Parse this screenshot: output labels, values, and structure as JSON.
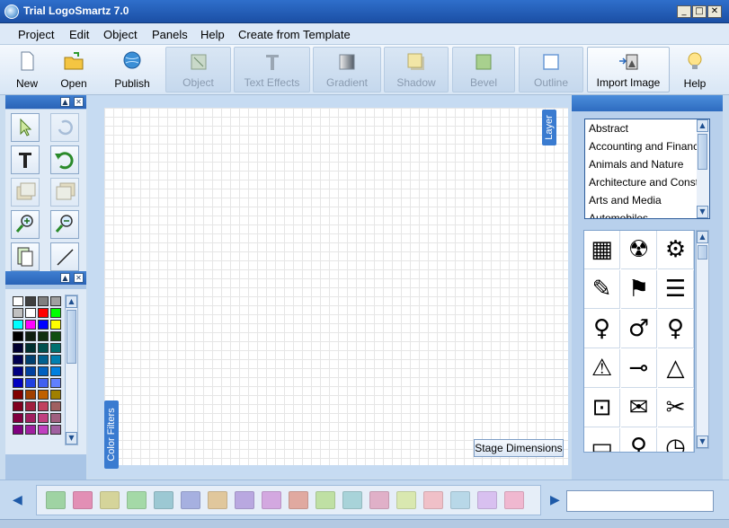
{
  "window": {
    "title": "Trial LogoSmartz 7.0",
    "minimize": "_",
    "maximize": "□",
    "close": "✕"
  },
  "menu": [
    "Project",
    "Edit",
    "Object",
    "Panels",
    "Help",
    "Create from Template"
  ],
  "toolbar": {
    "new": "New",
    "open": "Open",
    "publish": "Publish",
    "object": "Object",
    "text_effects": "Text Effects",
    "gradient": "Gradient",
    "shadow": "Shadow",
    "bevel": "Bevel",
    "outline": "Outline",
    "import_image": "Import Image",
    "help": "Help"
  },
  "panel_controls": {
    "up": "▲",
    "close": "✕"
  },
  "tabs": {
    "layer": "Layer",
    "color_filters": "Color Filters",
    "stage_dimensions": "Stage Dimensions"
  },
  "categories": [
    "Abstract",
    "Accounting and Finance",
    "Animals and Nature",
    "Architecture and Construction",
    "Arts and Media",
    "Automobiles"
  ],
  "symbols": [
    "▦",
    "☢",
    "⚙",
    "✎",
    "⚑",
    "☰",
    "♀",
    "♂",
    "♀",
    "⚠",
    "⊸",
    "△",
    "⊡",
    "✉",
    "✂",
    "▭",
    "♀",
    "◷"
  ],
  "palette_colors": [
    "#ffffff",
    "#404040",
    "#808080",
    "#a0a0a0",
    "#c0c0c0",
    "#ffffff",
    "#ff0000",
    "#00ff00",
    "#00ffff",
    "#ff00ff",
    "#0000ff",
    "#ffff00",
    "#000000",
    "#102010",
    "#103010",
    "#105010",
    "#000030",
    "#003030",
    "#005050",
    "#007070",
    "#000050",
    "#004070",
    "#006090",
    "#0080b0",
    "#000080",
    "#0040a0",
    "#0060c0",
    "#0080e0",
    "#0000c0",
    "#2040e0",
    "#4060f0",
    "#6080ff",
    "#800000",
    "#a04000",
    "#c06000",
    "#a08000",
    "#800020",
    "#a02040",
    "#c04060",
    "#a06060",
    "#800040",
    "#a02060",
    "#c04080",
    "#a06080",
    "#800080",
    "#a020a0",
    "#c040c0",
    "#a060a0"
  ],
  "filter_colors": [
    "#9fd3a3",
    "#e28fb5",
    "#d5d49a",
    "#a4d9a7",
    "#9cc8d3",
    "#a6b0e0",
    "#e0c79c",
    "#b9a8e0",
    "#d3a8e0",
    "#e0a9a0",
    "#bfe0a4",
    "#a8d3d9",
    "#e0b0c8",
    "#d9e8b0",
    "#f0c0c8",
    "#b8d8e8",
    "#d8c0f0",
    "#f0b8d0"
  ],
  "nav": {
    "left": "◀",
    "right": "▶"
  }
}
